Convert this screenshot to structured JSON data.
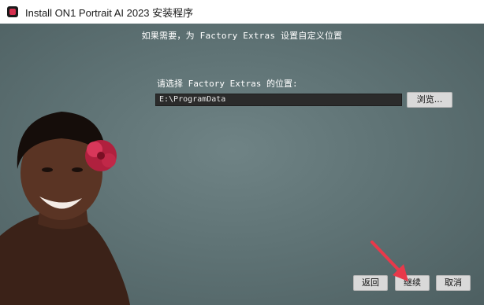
{
  "window": {
    "title": "Install ON1 Portrait AI 2023 安装程序",
    "app_icon": "on1-app-icon"
  },
  "header": {
    "text": "如果需要，为 Factory Extras 设置自定义位置"
  },
  "location": {
    "prompt": "请选择 Factory Extras 的位置:",
    "path_value": "E:\\ProgramData",
    "browse_label": "浏览..."
  },
  "footer": {
    "back_label": "返回",
    "next_label": "继续",
    "cancel_label": "取消"
  },
  "annotation": {
    "arrow_icon": "red-arrow-pointer-icon",
    "arrow_color": "#e8394a"
  },
  "colors": {
    "background": "#5d7173",
    "field_bg": "#2b2b2b",
    "button_bg": "#d9d9d9"
  }
}
